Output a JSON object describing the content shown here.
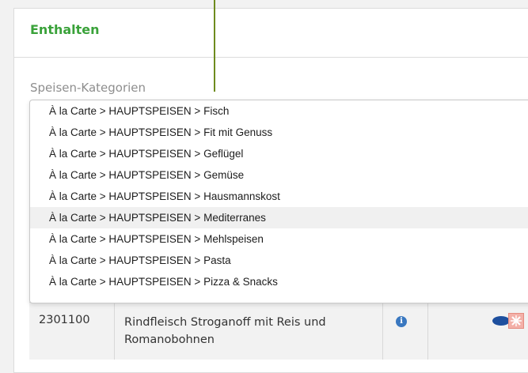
{
  "panel": {
    "title": "Enthalten"
  },
  "category_select": {
    "placeholder": "Speisen-Kategorien"
  },
  "dropdown": {
    "items": [
      "À la Carte > HAUPTSPEISEN > Fisch",
      "À la Carte > HAUPTSPEISEN > Fit mit Genuss",
      "À la Carte > HAUPTSPEISEN > Geflügel",
      "À la Carte > HAUPTSPEISEN > Gemüse",
      "À la Carte > HAUPTSPEISEN > Hausmannskost",
      "À la Carte > HAUPTSPEISEN > Mediterranes",
      "À la Carte > HAUPTSPEISEN > Mehlspeisen",
      "À la Carte > HAUPTSPEISEN > Pasta",
      "À la Carte > HAUPTSPEISEN > Pizza & Snacks"
    ],
    "highlighted_index": 5
  },
  "table": {
    "rows": [
      {
        "code": "2301100",
        "name": "Rindfleisch Stroganoff mit Reis und Romanobohnen",
        "icons": [
          "info-icon",
          "blue-oval-badge-icon",
          "red-cross-badge-icon"
        ]
      }
    ]
  },
  "colors": {
    "accent_green": "#3aa23a",
    "guide_line": "#6e8b1e",
    "info_blue": "#3a78c0"
  }
}
